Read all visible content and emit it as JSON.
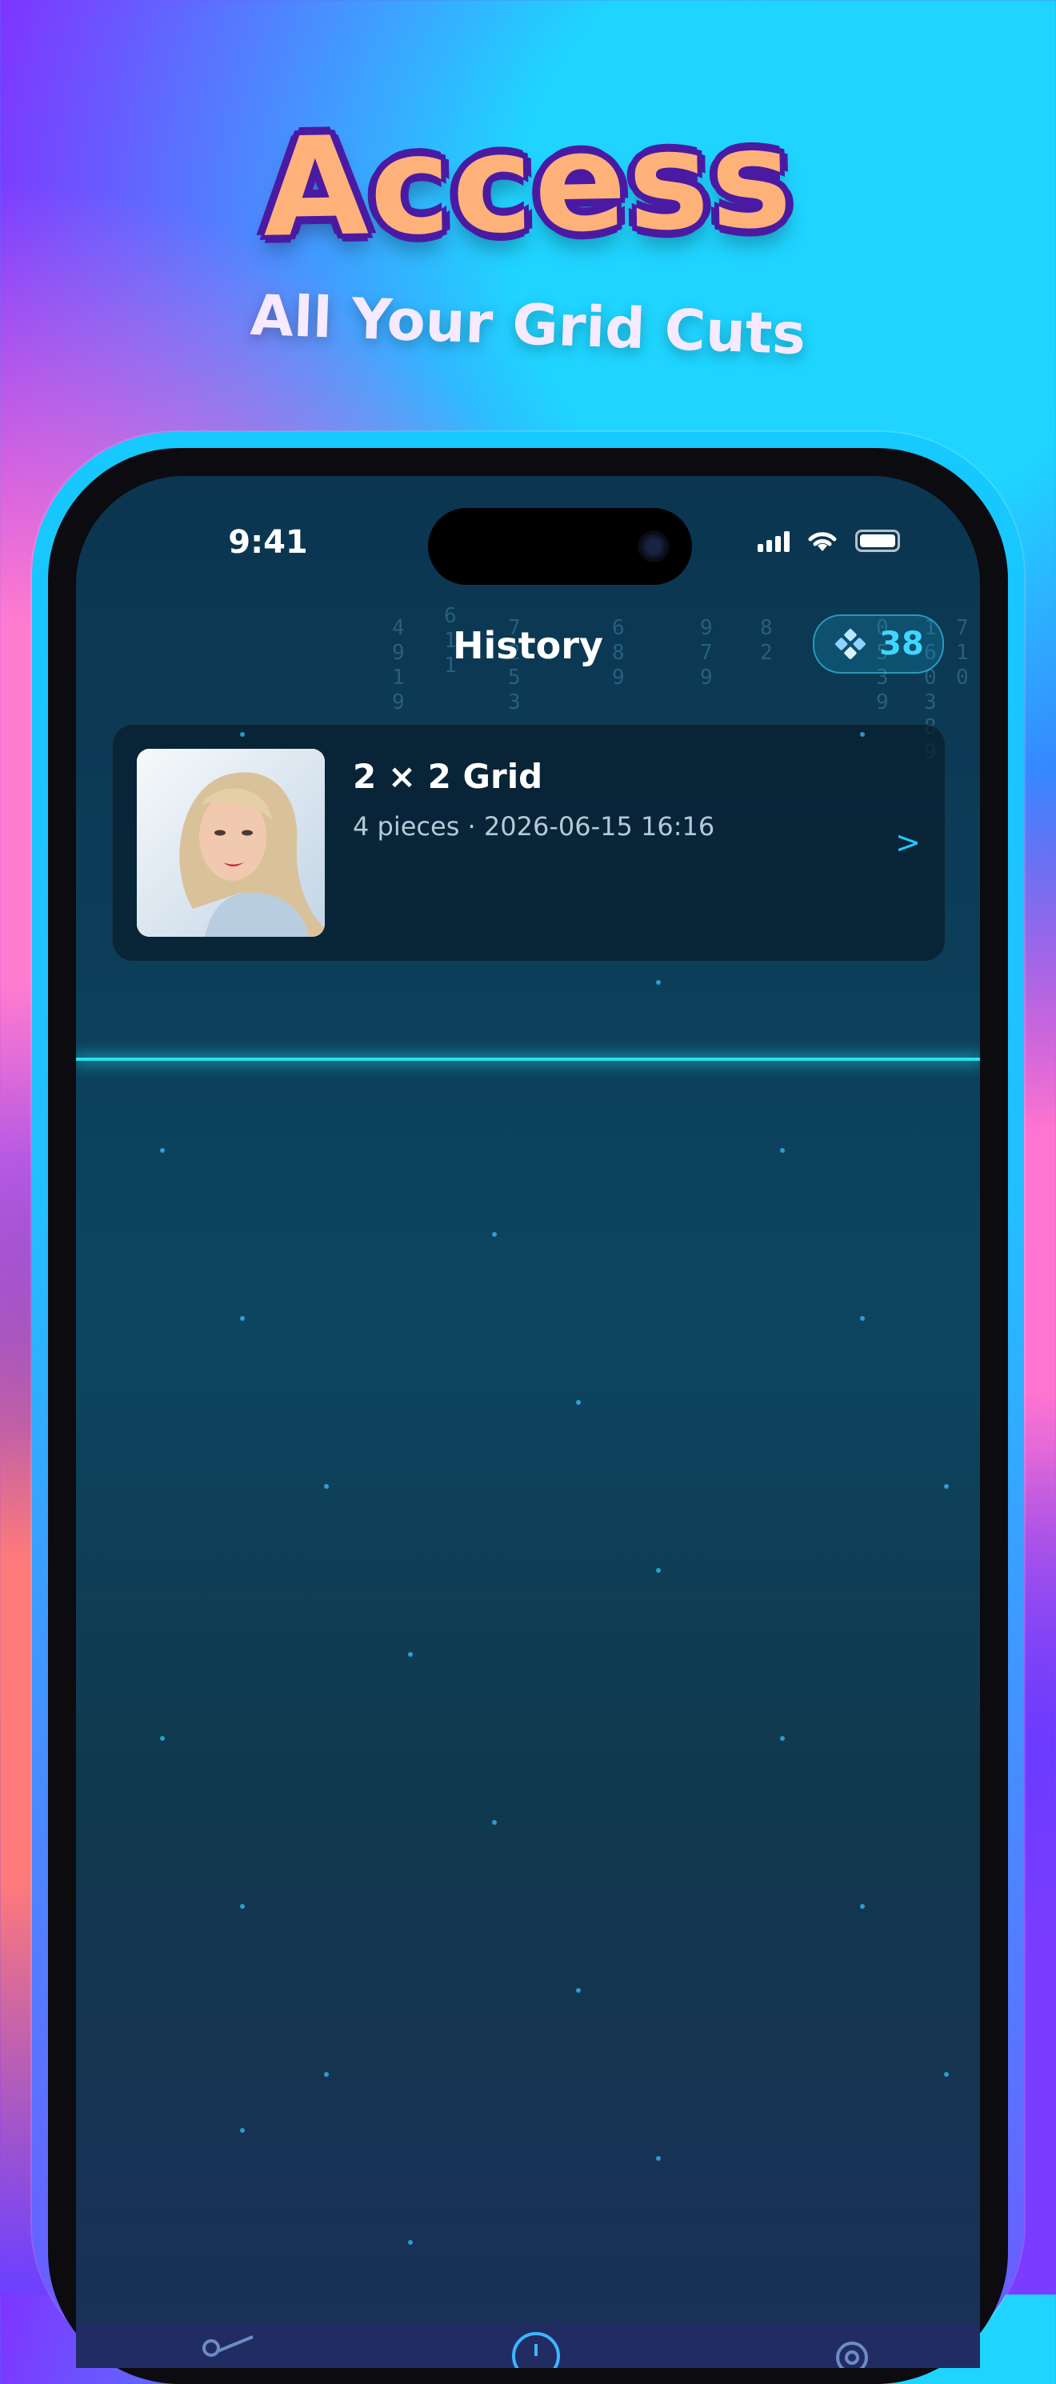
{
  "hero": {
    "title": "Access",
    "subtitle": "All Your Grid Cuts"
  },
  "status_bar": {
    "time": "9:41"
  },
  "nav": {
    "title": "History",
    "credits": "38"
  },
  "history": [
    {
      "title": "2 × 2 Grid",
      "meta": "4 pieces · 2026-06-15 16:16",
      "chevron": ">"
    }
  ],
  "colors": {
    "accent": "#3fd7ff",
    "scan_line": "#24e4f2",
    "screen_bg": "#0d4561"
  },
  "icons": {
    "credits": "diamond-grid-icon",
    "tab_cut": "scissors-icon",
    "tab_history": "clock-icon",
    "tab_settings": "gear-icon"
  }
}
